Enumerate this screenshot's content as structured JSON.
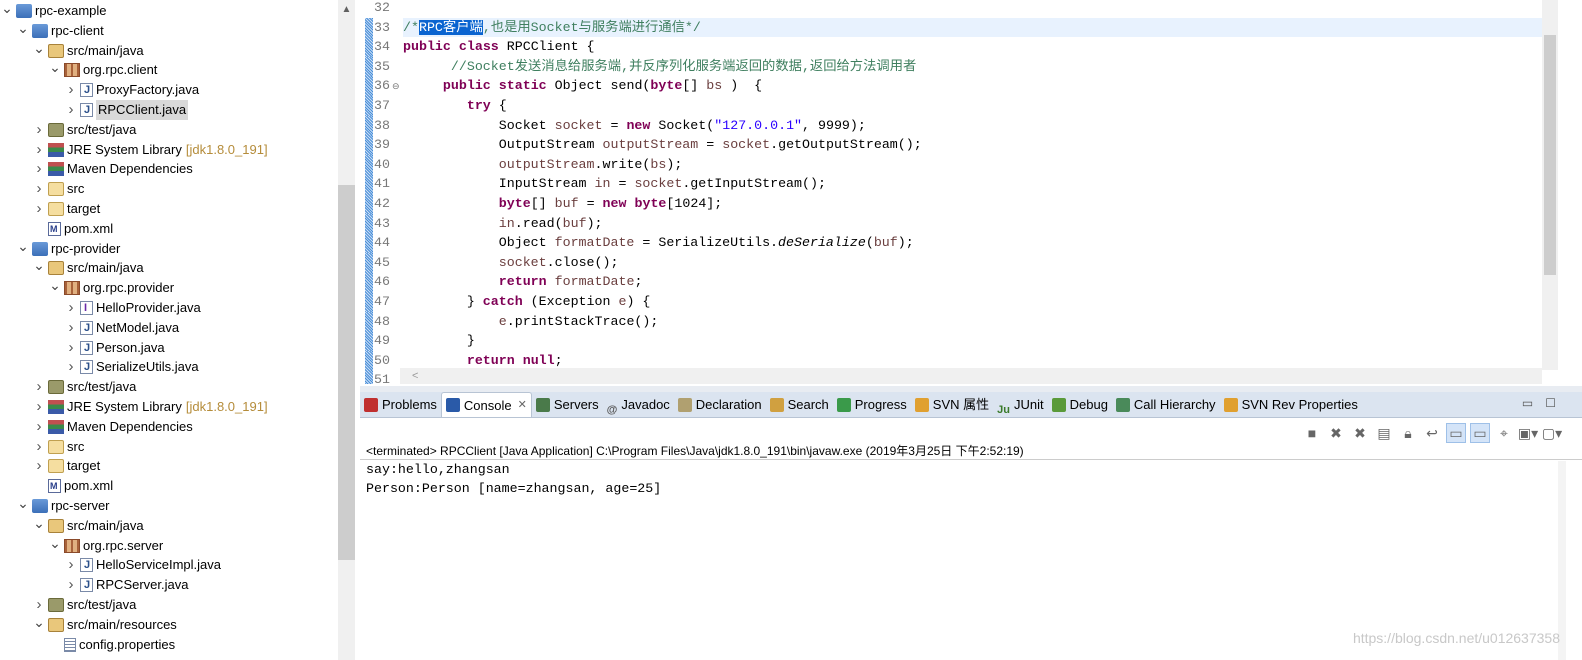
{
  "tree": [
    {
      "level": 0,
      "chevron": "down",
      "icon": "project",
      "label": "rpc-example"
    },
    {
      "level": 1,
      "chevron": "down",
      "icon": "project",
      "label": "rpc-client"
    },
    {
      "level": 2,
      "chevron": "down",
      "icon": "srcfolder",
      "label": "src/main/java"
    },
    {
      "level": 3,
      "chevron": "down",
      "icon": "package",
      "label": "org.rpc.client"
    },
    {
      "level": 4,
      "chevron": "right",
      "icon": "java",
      "label": "ProxyFactory.java"
    },
    {
      "level": 4,
      "chevron": "right",
      "icon": "java",
      "label": "RPCClient.java",
      "selected": true
    },
    {
      "level": 2,
      "chevron": "right",
      "icon": "testfolder",
      "label": "src/test/java"
    },
    {
      "level": 2,
      "chevron": "right",
      "icon": "library",
      "label": "JRE System Library",
      "suffix": "[jdk1.8.0_191]"
    },
    {
      "level": 2,
      "chevron": "right",
      "icon": "library",
      "label": "Maven Dependencies"
    },
    {
      "level": 2,
      "chevron": "right",
      "icon": "folder",
      "label": "src"
    },
    {
      "level": 2,
      "chevron": "right",
      "icon": "folder",
      "label": "target"
    },
    {
      "level": 2,
      "chevron": "",
      "icon": "pom",
      "label": "pom.xml"
    },
    {
      "level": 1,
      "chevron": "down",
      "icon": "project",
      "label": "rpc-provider"
    },
    {
      "level": 2,
      "chevron": "down",
      "icon": "srcfolder",
      "label": "src/main/java"
    },
    {
      "level": 3,
      "chevron": "down",
      "icon": "package",
      "label": "org.rpc.provider"
    },
    {
      "level": 4,
      "chevron": "right",
      "icon": "interface",
      "label": "HelloProvider.java"
    },
    {
      "level": 4,
      "chevron": "right",
      "icon": "java",
      "label": "NetModel.java"
    },
    {
      "level": 4,
      "chevron": "right",
      "icon": "java",
      "label": "Person.java"
    },
    {
      "level": 4,
      "chevron": "right",
      "icon": "java",
      "label": "SerializeUtils.java"
    },
    {
      "level": 2,
      "chevron": "right",
      "icon": "testfolder",
      "label": "src/test/java"
    },
    {
      "level": 2,
      "chevron": "right",
      "icon": "library",
      "label": "JRE System Library",
      "suffix": "[jdk1.8.0_191]"
    },
    {
      "level": 2,
      "chevron": "right",
      "icon": "library",
      "label": "Maven Dependencies"
    },
    {
      "level": 2,
      "chevron": "right",
      "icon": "folder",
      "label": "src"
    },
    {
      "level": 2,
      "chevron": "right",
      "icon": "folder",
      "label": "target"
    },
    {
      "level": 2,
      "chevron": "",
      "icon": "pom",
      "label": "pom.xml"
    },
    {
      "level": 1,
      "chevron": "down",
      "icon": "project",
      "label": "rpc-server"
    },
    {
      "level": 2,
      "chevron": "down",
      "icon": "srcfolder",
      "label": "src/main/java"
    },
    {
      "level": 3,
      "chevron": "down",
      "icon": "package",
      "label": "org.rpc.server"
    },
    {
      "level": 4,
      "chevron": "right",
      "icon": "java",
      "label": "HelloServiceImpl.java"
    },
    {
      "level": 4,
      "chevron": "right",
      "icon": "java",
      "label": "RPCServer.java"
    },
    {
      "level": 2,
      "chevron": "right",
      "icon": "testfolder",
      "label": "src/test/java"
    },
    {
      "level": 2,
      "chevron": "down",
      "icon": "srcfolder",
      "label": "src/main/resources"
    },
    {
      "level": 3,
      "chevron": "",
      "icon": "props",
      "label": "config.properties"
    }
  ],
  "editor": {
    "lines": [
      {
        "n": "32",
        "seg": []
      },
      {
        "n": "33",
        "cur": true,
        "seg": [
          [
            "cm",
            "/*"
          ],
          [
            "sl",
            "RPC客户端"
          ],
          [
            "cm",
            ",也是用Socket与服务端进行通信*/"
          ]
        ]
      },
      {
        "n": "34",
        "seg": [
          [
            "kw",
            "public"
          ],
          [
            "",
            " "
          ],
          [
            "kw",
            "class"
          ],
          [
            "",
            " RPCClient {"
          ]
        ]
      },
      {
        "n": "35",
        "seg": [
          [
            "",
            "      "
          ],
          [
            "cm",
            "//Socket发送消息给服务端,并反序列化服务端返回的数据,返回给方法调用者"
          ]
        ]
      },
      {
        "n": "36",
        "fold": true,
        "seg": [
          [
            "",
            "     "
          ],
          [
            "kw",
            "public"
          ],
          [
            "",
            " "
          ],
          [
            "kw",
            "static"
          ],
          [
            "",
            " Object send("
          ],
          [
            "kw",
            "byte"
          ],
          [
            "",
            "[] "
          ],
          [
            "vr",
            "bs"
          ],
          [
            "",
            " )  {"
          ]
        ]
      },
      {
        "n": "37",
        "seg": [
          [
            "",
            "        "
          ],
          [
            "kw",
            "try"
          ],
          [
            "",
            " {"
          ]
        ]
      },
      {
        "n": "38",
        "seg": [
          [
            "",
            "            Socket "
          ],
          [
            "vr",
            "socket"
          ],
          [
            "",
            " = "
          ],
          [
            "kw",
            "new"
          ],
          [
            "",
            " Socket("
          ],
          [
            "st",
            "\"127.0.0.1\""
          ],
          [
            "",
            ", 9999);"
          ]
        ]
      },
      {
        "n": "39",
        "seg": [
          [
            "",
            "            OutputStream "
          ],
          [
            "vr",
            "outputStream"
          ],
          [
            "",
            " = "
          ],
          [
            "vr",
            "socket"
          ],
          [
            "",
            ".getOutputStream();"
          ]
        ]
      },
      {
        "n": "40",
        "seg": [
          [
            "",
            "            "
          ],
          [
            "vr",
            "outputStream"
          ],
          [
            "",
            ".write("
          ],
          [
            "vr",
            "bs"
          ],
          [
            "",
            ");"
          ]
        ]
      },
      {
        "n": "41",
        "seg": [
          [
            "",
            "            InputStream "
          ],
          [
            "vr",
            "in"
          ],
          [
            "",
            " = "
          ],
          [
            "vr",
            "socket"
          ],
          [
            "",
            ".getInputStream();"
          ]
        ]
      },
      {
        "n": "42",
        "seg": [
          [
            "",
            "            "
          ],
          [
            "kw",
            "byte"
          ],
          [
            "",
            "[] "
          ],
          [
            "vr",
            "buf"
          ],
          [
            "",
            " = "
          ],
          [
            "kw",
            "new"
          ],
          [
            "",
            " "
          ],
          [
            "kw",
            "byte"
          ],
          [
            "",
            "[1024];"
          ]
        ]
      },
      {
        "n": "43",
        "seg": [
          [
            "",
            "            "
          ],
          [
            "vr",
            "in"
          ],
          [
            "",
            ".read("
          ],
          [
            "vr",
            "buf"
          ],
          [
            "",
            ");"
          ]
        ]
      },
      {
        "n": "44",
        "seg": [
          [
            "",
            "            Object "
          ],
          [
            "vr",
            "formatDate"
          ],
          [
            "",
            " = SerializeUtils."
          ],
          [
            "it",
            "deSerialize"
          ],
          [
            "",
            "("
          ],
          [
            "vr",
            "buf"
          ],
          [
            "",
            ");"
          ]
        ]
      },
      {
        "n": "45",
        "seg": [
          [
            "",
            "            "
          ],
          [
            "vr",
            "socket"
          ],
          [
            "",
            ".close();"
          ]
        ]
      },
      {
        "n": "46",
        "seg": [
          [
            "",
            "            "
          ],
          [
            "kw",
            "return"
          ],
          [
            "",
            " "
          ],
          [
            "vr",
            "formatDate"
          ],
          [
            "",
            ";"
          ]
        ]
      },
      {
        "n": "47",
        "seg": [
          [
            "",
            "        } "
          ],
          [
            "kw",
            "catch"
          ],
          [
            "",
            " (Exception "
          ],
          [
            "vr",
            "e"
          ],
          [
            "",
            ") {"
          ]
        ]
      },
      {
        "n": "48",
        "seg": [
          [
            "",
            "            "
          ],
          [
            "vr",
            "e"
          ],
          [
            "",
            ".printStackTrace();"
          ]
        ]
      },
      {
        "n": "49",
        "seg": [
          [
            "",
            "        }"
          ]
        ]
      },
      {
        "n": "50",
        "seg": [
          [
            "",
            "        "
          ],
          [
            "kw",
            "return"
          ],
          [
            "",
            " "
          ],
          [
            "kw",
            "null"
          ],
          [
            "",
            ";"
          ]
        ]
      },
      {
        "n": "51",
        "seg": [
          [
            "",
            "    }"
          ]
        ]
      }
    ]
  },
  "tabs": [
    {
      "label": "Problems",
      "icon": "problems-icon",
      "color": "#c03030"
    },
    {
      "label": "Console",
      "icon": "console-icon",
      "color": "#2a5aa8",
      "active": true,
      "close": "✕"
    },
    {
      "label": "Servers",
      "icon": "servers-icon",
      "color": "#4a7a4a"
    },
    {
      "label": "Javadoc",
      "icon": "at-icon",
      "glyph": "@"
    },
    {
      "label": "Declaration",
      "icon": "declaration-icon",
      "color": "#b0a070"
    },
    {
      "label": "Search",
      "icon": "search-icon",
      "color": "#d0a040"
    },
    {
      "label": "Progress",
      "icon": "progress-icon",
      "color": "#3a9a4a"
    },
    {
      "label": "SVN 属性",
      "icon": "svn-icon",
      "color": "#e0a030"
    },
    {
      "label": "JUnit",
      "icon": "junit-icon",
      "glyph": "Ju"
    },
    {
      "label": "Debug",
      "icon": "debug-icon",
      "color": "#5a9a3a"
    },
    {
      "label": "Call Hierarchy",
      "icon": "call-hierarchy-icon",
      "color": "#4a8a5a"
    },
    {
      "label": "SVN Rev Properties",
      "icon": "svn-icon",
      "color": "#e0a030"
    }
  ],
  "console": {
    "status": "<terminated> RPCClient [Java Application] C:\\Program Files\\Java\\jdk1.8.0_191\\bin\\javaw.exe (2019年3月25日 下午2:52:19)",
    "output": [
      "say:hello,zhangsan",
      "Person:Person [name=zhangsan, age=25]"
    ]
  },
  "watermark": "https://blog.csdn.net/u012637358"
}
